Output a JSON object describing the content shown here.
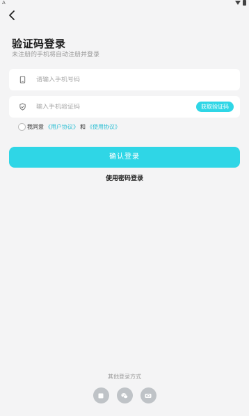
{
  "status_bar": {
    "left_text": "A"
  },
  "page": {
    "title": "验证码登录",
    "subtitle": "未注册的手机将自动注册并登录"
  },
  "phone_field": {
    "placeholder": "请输入手机号码",
    "value": ""
  },
  "code_field": {
    "placeholder": "输入手机验证码",
    "value": "",
    "get_code_label": "获取验证码"
  },
  "agreement": {
    "prefix": "我同意",
    "user_agreement": "《用户协议》",
    "and": "和",
    "usage_agreement": "《使用协议》",
    "checked": false
  },
  "actions": {
    "confirm_label": "确认登录",
    "password_login_label": "使用密码登录"
  },
  "other_login": {
    "label": "其他登录方式",
    "methods": [
      "square-icon",
      "wechat-icon",
      "id-icon"
    ]
  },
  "colors": {
    "accent": "#2fd6e6",
    "link": "#2dbfd4",
    "background": "#f4f4f5"
  }
}
